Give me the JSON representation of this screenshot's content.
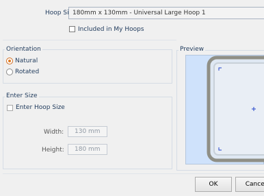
{
  "hoop": {
    "label": "Hoop Size:",
    "selected": "180mm x 130mm - Universal Large Hoop 1",
    "included_label": "Included in My Hoops"
  },
  "orientation": {
    "title": "Orientation",
    "options": [
      "Natural",
      "Rotated"
    ],
    "selected": "Natural"
  },
  "enter_size": {
    "title": "Enter Size",
    "checkbox_label": "Enter Hoop Size",
    "width_label": "Width:",
    "width_value": "130 mm",
    "height_label": "Height:",
    "height_value": "180 mm"
  },
  "preview": {
    "title": "Preview"
  },
  "buttons": {
    "ok": "OK",
    "cancel": "Cancel"
  },
  "colors": {
    "accent": "#e07b22",
    "preview_bg": "#cfe2fb",
    "crosshair": "#2244cc"
  }
}
